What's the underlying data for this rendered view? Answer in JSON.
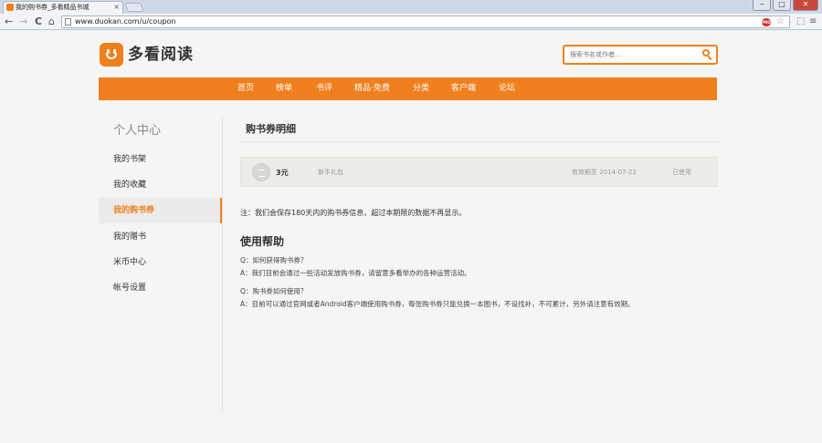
{
  "browser": {
    "tab_title": "我的购书券_多看精品书城",
    "tab_close": "×",
    "url": "www.duokan.com/u/coupon",
    "back": "←",
    "forward": "→",
    "reload": "C",
    "home": "⌂",
    "win_min": "‒",
    "win_max": "□",
    "win_close": "✕",
    "ext_badge": "PRO",
    "star": "☆",
    "menu": "≡"
  },
  "site": {
    "logo_text": "多看阅读",
    "search_placeholder": "搜索书名或作者..."
  },
  "nav": {
    "items": [
      "首页",
      "榜单",
      "书评",
      "精品·免费",
      "分类",
      "客户端",
      "论坛"
    ]
  },
  "sidebar": {
    "title": "个人中心",
    "items": [
      "我的书架",
      "我的收藏",
      "我的购书券",
      "我的赠书",
      "米币中心",
      "帐号设置"
    ]
  },
  "main": {
    "title": "购书券明细",
    "coupons": [
      {
        "amount": "3元",
        "name": "新手礼包",
        "validity": "有效期至 2014-07-22",
        "status": "已使用"
      }
    ],
    "note": "注：我们会保存180天内的购书券信息，超过本期限的数据不再显示。",
    "help_title": "使用帮助",
    "help": [
      {
        "q": "Q：如何获得购书券？",
        "a": "A：我们目前会通过一些活动发放购书券，请留意多看举办的各种运营活动。"
      },
      {
        "q": "Q：购书券如何使用？",
        "a": "A：目前可以通过官网或者Android客户端使用购书券，每张购书券只能兑换一本图书，不设找补，不可累计，另外请注意有效期。"
      }
    ]
  },
  "colors": {
    "accent": "#f07f1e",
    "background": "#f5f5f3"
  }
}
